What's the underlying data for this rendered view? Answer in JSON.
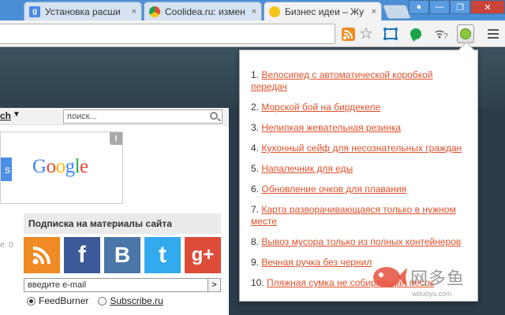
{
  "tabs": [
    {
      "label": "Установка расши",
      "favicon": "google-g",
      "favicon_color": "#4a86e8",
      "active": false
    },
    {
      "label": "Coolidea.ru: измен",
      "favicon": "chrome",
      "favicon_color": "#dd4b39",
      "active": false
    },
    {
      "label": "Бизнес идеи – Жу",
      "favicon": "bulb",
      "favicon_color": "#f5c518",
      "active": true
    }
  ],
  "tab_close_glyph": "×",
  "page": {
    "nav_fragment": "ch",
    "nav_arrow": "▼",
    "search_placeholder": "поиск...",
    "ad_button_fragment": "s",
    "ad_logo": "Google",
    "ad_info": "i",
    "subscribe_header": "Подписка на материалы сайта",
    "left_fragment": "e: 0",
    "social": [
      {
        "name": "rss",
        "glyph": "",
        "color": "#f08a24"
      },
      {
        "name": "facebook",
        "glyph": "f",
        "color": "#3b5998"
      },
      {
        "name": "vkontakte",
        "glyph": "B",
        "color": "#4a76a8"
      },
      {
        "name": "twitter",
        "glyph": "t",
        "color": "#33aaee"
      },
      {
        "name": "google-plus",
        "glyph": "g+",
        "color": "#dd4b39"
      }
    ],
    "email_placeholder": "введите e-mail",
    "email_go": ">",
    "radio_options": [
      {
        "label": "FeedBurner",
        "selected": true
      },
      {
        "label": "Subscribe.ru",
        "selected": false
      }
    ]
  },
  "ideas": [
    {
      "number": "1.",
      "text": "Велосипед с автоматической коробкой передач"
    },
    {
      "number": "2.",
      "text": "Морской бой на бирдекеле"
    },
    {
      "number": "3.",
      "text": "Нелипкая жевательная резинка"
    },
    {
      "number": "4.",
      "text": "Кухонный сейф для несознательных граждан"
    },
    {
      "number": "5.",
      "text": "Напалечник для еды"
    },
    {
      "number": "6.",
      "text": "Обновление очков для плавания"
    },
    {
      "number": "7.",
      "text": "Карта разворачивающаяся только в нужном месте"
    },
    {
      "number": "8.",
      "text": "Вывоз мусора только из полных контейнеров"
    },
    {
      "number": "9.",
      "text": "Вечная ручка без чернил"
    },
    {
      "number": "10.",
      "text": "Пляжная сумка не собирающая песок"
    }
  ],
  "watermark": {
    "text": "网多鱼",
    "url": "wduoyu.com"
  },
  "colors": {
    "link": "#e0502a",
    "tabstrip": "#4a8fd6",
    "page_bg": "#2a3c48"
  }
}
